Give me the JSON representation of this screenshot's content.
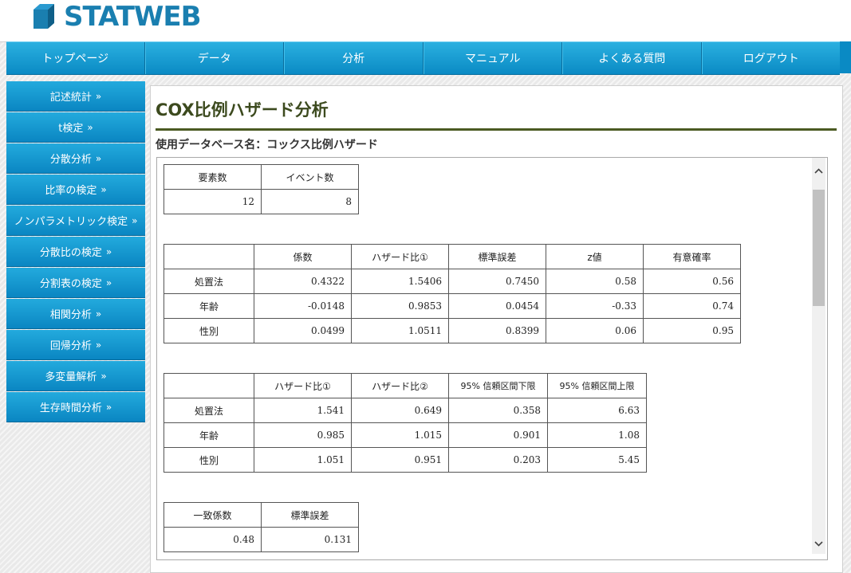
{
  "brand": {
    "logo_text": "STATWEB",
    "color": "#1a7fb0"
  },
  "nav": {
    "items": [
      {
        "label": "トップページ"
      },
      {
        "label": "データ"
      },
      {
        "label": "分析"
      },
      {
        "label": "マニュアル"
      },
      {
        "label": "よくある質問"
      },
      {
        "label": "ログアウト"
      }
    ]
  },
  "sidebar": {
    "chevron": "»",
    "items": [
      {
        "label": "記述統計"
      },
      {
        "label": "t検定"
      },
      {
        "label": "分散分析"
      },
      {
        "label": "比率の検定"
      },
      {
        "label": "ノンパラメトリック検定"
      },
      {
        "label": "分散比の検定"
      },
      {
        "label": "分割表の検定"
      },
      {
        "label": "相関分析"
      },
      {
        "label": "回帰分析"
      },
      {
        "label": "多変量解析"
      },
      {
        "label": "生存時間分析"
      }
    ]
  },
  "main": {
    "title": "COX比例ハザード分析",
    "database_label": "使用データベース名：コックス比例ハザード"
  },
  "summary_table": {
    "headers": [
      "要素数",
      "イベント数"
    ],
    "values": [
      "12",
      "8"
    ]
  },
  "coef_table": {
    "headers": [
      "",
      "係数",
      "ハザード比①",
      "標準誤差",
      "z値",
      "有意確率"
    ],
    "rows": [
      [
        "処置法",
        "0.4322",
        "1.5406",
        "0.7450",
        "0.58",
        "0.56"
      ],
      [
        "年齢",
        "-0.0148",
        "0.9853",
        "0.0454",
        "-0.33",
        "0.74"
      ],
      [
        "性別",
        "0.0499",
        "1.0511",
        "0.8399",
        "0.06",
        "0.95"
      ]
    ]
  },
  "ci_table": {
    "headers": [
      "",
      "ハザード比①",
      "ハザード比②",
      "95% 信頼区間下限",
      "95% 信頼区間上限"
    ],
    "rows": [
      [
        "処置法",
        "1.541",
        "0.649",
        "0.358",
        "6.63"
      ],
      [
        "年齢",
        "0.985",
        "1.015",
        "0.901",
        "1.08"
      ],
      [
        "性別",
        "1.051",
        "0.951",
        "0.203",
        "5.45"
      ]
    ]
  },
  "concordance_table": {
    "headers": [
      "一致係数",
      "標準誤差"
    ],
    "values": [
      "0.48",
      "0.131"
    ]
  },
  "scrollbar": {
    "up_icon": "chevron-up",
    "down_icon": "chevron-down"
  },
  "colors": {
    "nav": "#1a9fd6",
    "title": "#3c4a1e",
    "rule": "#4b5a22"
  }
}
